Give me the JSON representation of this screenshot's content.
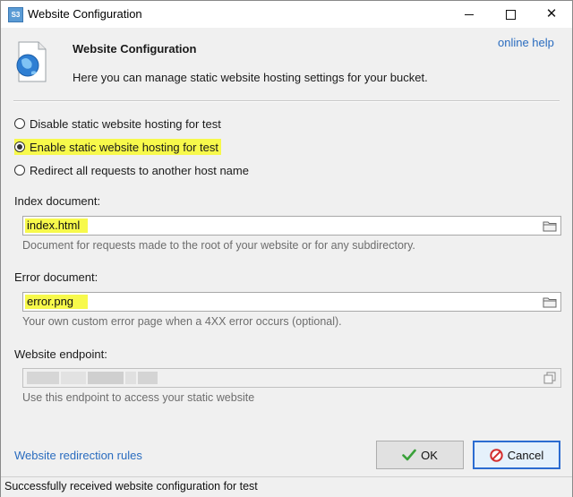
{
  "window": {
    "title": "Website Configuration",
    "app_icon": "S3",
    "controls": [
      "minimize",
      "maximize",
      "close"
    ]
  },
  "header": {
    "title": "Website Configuration",
    "description": "Here you can manage static website hosting settings for your bucket.",
    "help_link": "online help",
    "icon": "globe-document-icon"
  },
  "hosting_options": [
    {
      "label": "Disable static website hosting for test",
      "checked": false
    },
    {
      "label": "Enable static website hosting for test",
      "checked": true
    },
    {
      "label": "Redirect all requests to another host name",
      "checked": false
    }
  ],
  "index_document": {
    "label": "Index document:",
    "value": "index.html",
    "hint": "Document for requests made to the root of your website or for any subdirectory."
  },
  "error_document": {
    "label": "Error document:",
    "value": "error.png",
    "hint": "Your own custom error page when a 4XX error occurs (optional)."
  },
  "website_endpoint": {
    "label": "Website endpoint:",
    "value": "",
    "hint": "Use this endpoint to access your static website"
  },
  "footer": {
    "redirection_link": "Website redirection rules",
    "ok_label": "OK",
    "cancel_label": "Cancel"
  },
  "status": {
    "text": "Successfully received website configuration for test"
  },
  "colors": {
    "highlight": "#f7f94b",
    "link": "#2a6cbf",
    "default_button_border": "#2b6cd1"
  }
}
